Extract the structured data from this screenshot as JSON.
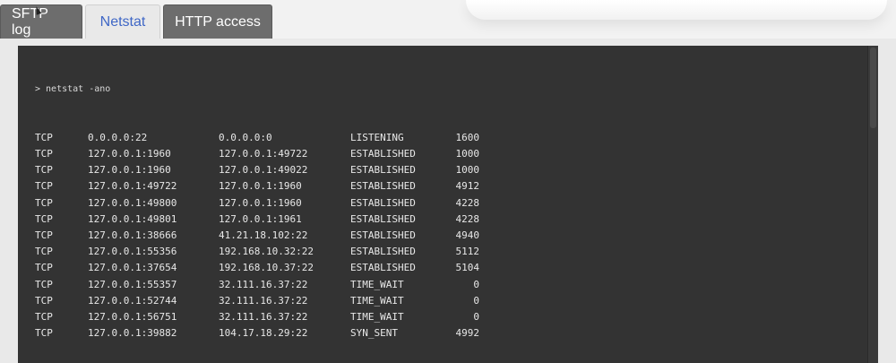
{
  "tabs": [
    {
      "label": "SFTP log",
      "active": false
    },
    {
      "label": "Netstat",
      "active": true
    },
    {
      "label": "HTTP access",
      "active": false
    }
  ],
  "terminal": {
    "command": "> netstat -ano",
    "rows": [
      {
        "proto": "TCP",
        "local": "0.0.0.0:22",
        "foreign": "0.0.0.0:0",
        "state": "LISTENING",
        "pid": "1600"
      },
      {
        "proto": "TCP",
        "local": "127.0.0.1:1960",
        "foreign": "127.0.0.1:49722",
        "state": "ESTABLISHED",
        "pid": "1000"
      },
      {
        "proto": "TCP",
        "local": "127.0.0.1:1960",
        "foreign": "127.0.0.1:49022",
        "state": "ESTABLISHED",
        "pid": "1000"
      },
      {
        "proto": "TCP",
        "local": "127.0.0.1:49722",
        "foreign": "127.0.0.1:1960",
        "state": "ESTABLISHED",
        "pid": "4912"
      },
      {
        "proto": "TCP",
        "local": "127.0.0.1:49800",
        "foreign": "127.0.0.1:1960",
        "state": "ESTABLISHED",
        "pid": "4228"
      },
      {
        "proto": "TCP",
        "local": "127.0.0.1:49801",
        "foreign": "127.0.0.1:1961",
        "state": "ESTABLISHED",
        "pid": "4228"
      },
      {
        "proto": "TCP",
        "local": "127.0.0.1:38666",
        "foreign": "41.21.18.102:22",
        "state": "ESTABLISHED",
        "pid": "4940"
      },
      {
        "proto": "TCP",
        "local": "127.0.0.1:55356",
        "foreign": "192.168.10.32:22",
        "state": "ESTABLISHED",
        "pid": "5112"
      },
      {
        "proto": "TCP",
        "local": "127.0.0.1:37654",
        "foreign": "192.168.10.37:22",
        "state": "ESTABLISHED",
        "pid": "5104"
      },
      {
        "proto": "TCP",
        "local": "127.0.0.1:55357",
        "foreign": "32.111.16.37:22",
        "state": "TIME_WAIT",
        "pid": "0"
      },
      {
        "proto": "TCP",
        "local": "127.0.0.1:52744",
        "foreign": "32.111.16.37:22",
        "state": "TIME_WAIT",
        "pid": "0"
      },
      {
        "proto": "TCP",
        "local": "127.0.0.1:56751",
        "foreign": "32.111.16.37:22",
        "state": "TIME_WAIT",
        "pid": "0"
      },
      {
        "proto": "TCP",
        "local": "127.0.0.1:39882",
        "foreign": "104.17.18.29:22",
        "state": "SYN_SENT",
        "pid": "4992"
      }
    ]
  },
  "colors": {
    "terminal_bg": "#333333",
    "terminal_text": "#e8e8e8",
    "active_tab_text": "#3f67c6",
    "inactive_tab_bg": "#6d6d6d"
  }
}
